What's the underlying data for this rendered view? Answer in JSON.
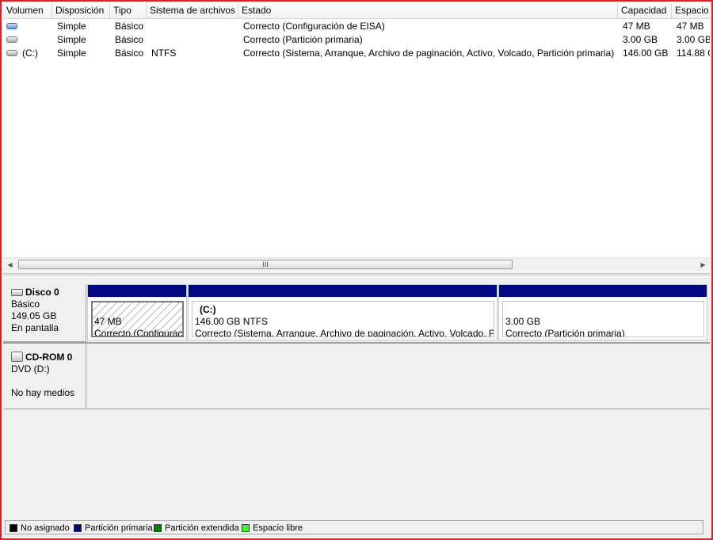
{
  "list": {
    "columns": [
      "Volumen",
      "Disposición",
      "Tipo",
      "Sistema de archivos",
      "Estado",
      "Capacidad",
      "Espacio"
    ],
    "rows": [
      {
        "icon": "blue-volume-icon",
        "volume": "",
        "layout": "Simple",
        "type": "Básico",
        "fs": "",
        "status": "Correcto (Configuración de EISA)",
        "capacity": "47 MB",
        "free": "47 MB"
      },
      {
        "icon": "volume-icon",
        "volume": "",
        "layout": "Simple",
        "type": "Básico",
        "fs": "",
        "status": "Correcto (Partición primaria)",
        "capacity": "3.00 GB",
        "free": "3.00 GB"
      },
      {
        "icon": "volume-icon",
        "volume": "(C:)",
        "layout": "Simple",
        "type": "Básico",
        "fs": "NTFS",
        "status": "Correcto (Sistema, Arranque, Archivo de paginación, Activo, Volcado, Partición primaria)",
        "capacity": "146.00 GB",
        "free": "114.88 G"
      }
    ],
    "scroll_grip": "III"
  },
  "disks": [
    {
      "name": "Disco 0",
      "type": "Básico",
      "size": "149.05 GB",
      "state": "En pantalla"
    },
    {
      "name": "CD-ROM 0",
      "type": "DVD (D:)",
      "size": "",
      "state": "No hay medios"
    }
  ],
  "partitions": [
    {
      "title": "",
      "size": "47 MB",
      "status": "Correcto (Configuración de EISA)"
    },
    {
      "title": "(C:)",
      "size": "146.00 GB NTFS",
      "status": "Correcto (Sistema, Arranque, Archivo de paginación, Activo, Volcado, P"
    },
    {
      "title": "",
      "size": "3.00 GB",
      "status": "Correcto (Partición primaria)"
    }
  ],
  "legend": [
    {
      "label": "No asignado",
      "color": "#000000"
    },
    {
      "label": "Partición primaria",
      "color": "#000a80"
    },
    {
      "label": "Partición extendida",
      "color": "#008000"
    },
    {
      "label": "Espacio libre",
      "color": "#33ff33"
    }
  ],
  "colors": {
    "primary_partition_band": "#000a80",
    "frame_border": "#e02020"
  }
}
